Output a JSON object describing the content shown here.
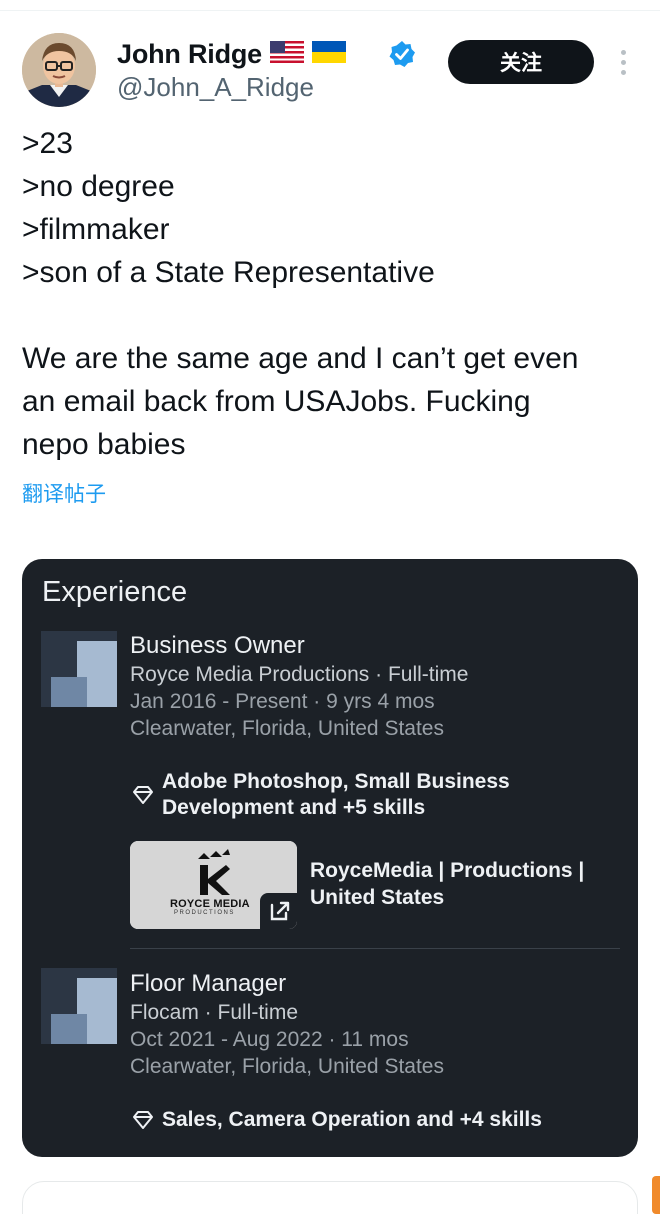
{
  "tweet": {
    "author": {
      "display_name": "John Ridge",
      "handle": "@John_A_Ridge",
      "flags": [
        "us-flag-icon",
        "ukraine-flag-icon"
      ],
      "verified": true
    },
    "follow_label": "关注",
    "text_lines": [
      ">23",
      ">no degree",
      ">filmmaker",
      ">son of a State Representative"
    ],
    "text_paragraph_lines": [
      "We are the same age and I can’t get even",
      "an email back from USAJobs. Fucking",
      "nepo babies"
    ],
    "translate_label": "翻译帖子"
  },
  "experience": {
    "title": "Experience",
    "jobs": [
      {
        "title": "Business Owner",
        "company": "Royce Media Productions · Full-time",
        "dates": "Jan 2016 - Present · 9 yrs 4 mos",
        "location": "Clearwater, Florida, United States",
        "skills_lines": [
          "Adobe Photoshop, Small Business",
          "Development and +5 skills"
        ],
        "media": {
          "logo_text": "ROYCE MEDIA",
          "logo_subtext": "PRODUCTIONS",
          "title_lines": [
            "RoyceMedia | Productions |",
            "United States"
          ]
        }
      },
      {
        "title": "Floor Manager",
        "company": "Flocam · Full-time",
        "dates": "Oct 2021 - Aug 2022 · 11 mos",
        "location": "Clearwater, Florida, United States",
        "skills_lines": [
          "Sales, Camera Operation and +4 skills"
        ]
      }
    ]
  },
  "colors": {
    "accent_blue": "#1d9bf0",
    "card_bg": "#1c2127",
    "follow_bg": "#0f1419"
  }
}
